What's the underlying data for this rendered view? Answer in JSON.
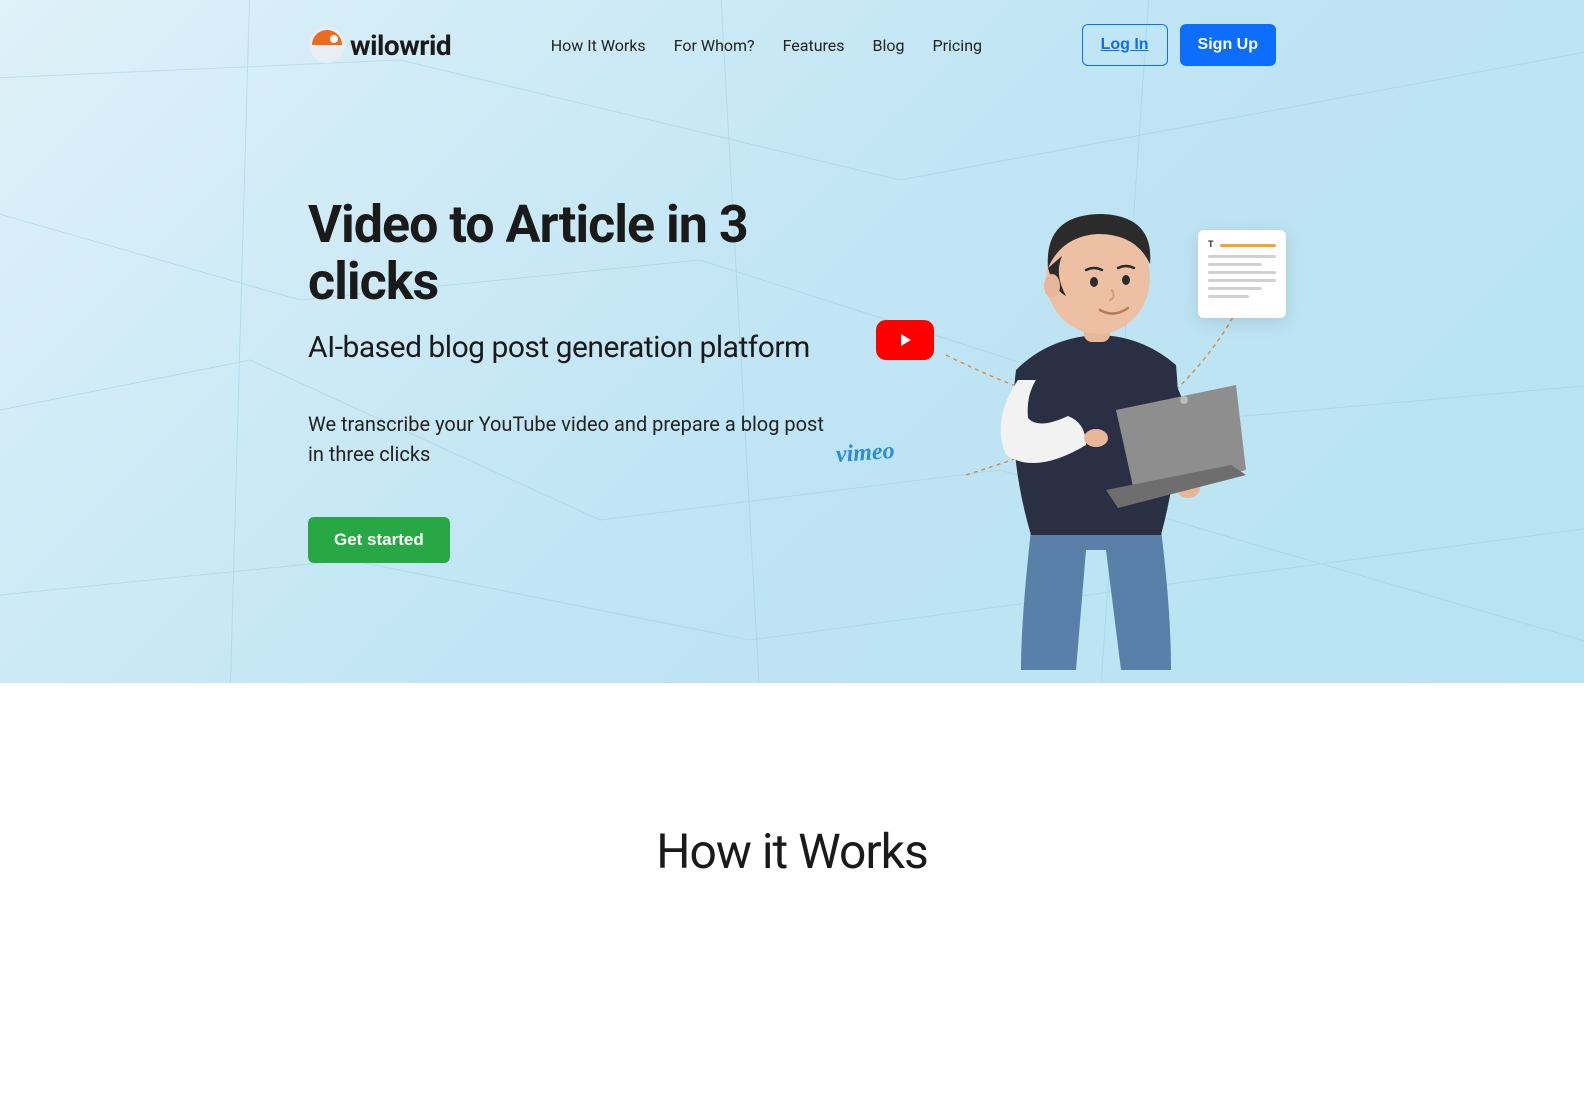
{
  "brand": {
    "name": "wilowrid"
  },
  "nav": {
    "items": [
      {
        "label": "How It Works"
      },
      {
        "label": "For Whom?"
      },
      {
        "label": "Features"
      },
      {
        "label": "Blog"
      },
      {
        "label": "Pricing"
      }
    ]
  },
  "auth": {
    "login": "Log In",
    "signup": "Sign Up"
  },
  "hero": {
    "title": "Video to Article in 3 clicks",
    "subtitle": "AI-based blog post generation platform",
    "description": "We transcribe your YouTube video and prepare a blog post in three clicks",
    "cta": "Get started",
    "vimeo_label": "vimeo",
    "doc_letter": "T"
  },
  "section2": {
    "title": "How it Works"
  },
  "colors": {
    "primary": "#0d6efd",
    "success": "#28a745",
    "youtube": "#ff0000",
    "vimeo": "#2d8dd6",
    "brand_orange": "#ed6b1f"
  }
}
